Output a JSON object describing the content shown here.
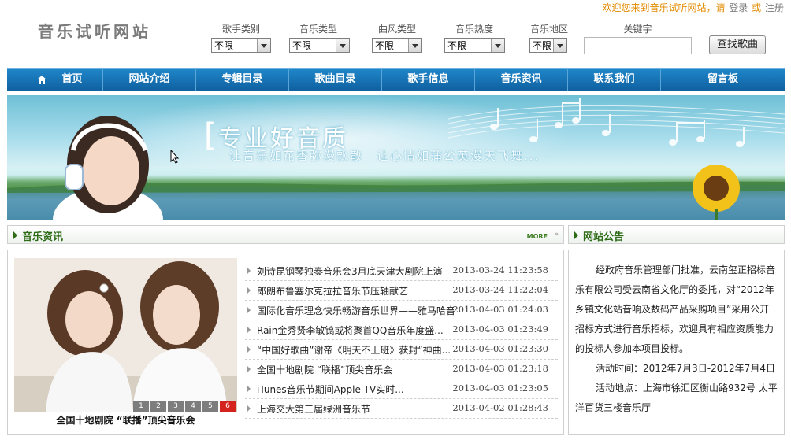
{
  "header": {
    "site_title": "音乐试听网站",
    "welcome_text": "欢迎您来到音乐试听网站，请",
    "login_label": "登录",
    "or_text": "或",
    "register_label": "注册"
  },
  "filters": [
    {
      "label": "歌手类别",
      "value": "不限"
    },
    {
      "label": "音乐类型",
      "value": "不限"
    },
    {
      "label": "曲风类型",
      "value": "不限"
    },
    {
      "label": "音乐热度",
      "value": "不限"
    },
    {
      "label": "音乐地区",
      "value": "不限"
    }
  ],
  "search": {
    "keyword_label": "关键字",
    "keyword_value": "",
    "button_label": "查找歌曲"
  },
  "nav": {
    "items": [
      "首页",
      "网站介绍",
      "专辑目录",
      "歌曲目录",
      "歌手信息",
      "音乐资讯",
      "联系我们",
      "留言板"
    ]
  },
  "banner": {
    "title": "专业好音质",
    "subtitle": "让音乐如花香弥漫飘散　让心情如蒲公英漫天飞舞..."
  },
  "news_section": {
    "title": "音乐资讯",
    "more_label": "MORE",
    "more_arrows": "»",
    "photo_caption": "全国十地剧院 “联播”顶尖音乐会",
    "pager": [
      "1",
      "2",
      "3",
      "4",
      "5",
      "6"
    ],
    "pager_active": "6",
    "items": [
      {
        "title": "刘诗昆钢琴独奏音乐会3月底天津大剧院上演",
        "date": "2013-03-24 11:23:58"
      },
      {
        "title": "郎朗布鲁塞尔克拉拉音乐节压轴献艺",
        "date": "2013-03-24 11:22:04"
      },
      {
        "title": "国际化音乐理念快乐畅游音乐世界——雅马哈音...",
        "date": "2013-04-03 01:24:03"
      },
      {
        "title": "Rain金秀贤李敏镐或将聚首QQ音乐年度盛...",
        "date": "2013-04-03 01:23:49"
      },
      {
        "title": "“中国好歌曲”谢帝《明天不上班》获封“神曲...",
        "date": "2013-04-03 01:23:30"
      },
      {
        "title": "全国十地剧院 “联播”顶尖音乐会",
        "date": "2013-04-03 01:23:18"
      },
      {
        "title": "iTunes音乐节期间Apple TV实时...",
        "date": "2013-04-03 01:23:05"
      },
      {
        "title": "上海交大第三届绿洲音乐节",
        "date": "2013-04-02 01:28:43"
      }
    ]
  },
  "notice_section": {
    "title": "网站公告",
    "paragraphs": [
      "经政府音乐管理部门批准，云南玺正招标音乐有限公司受云南省文化厅的委托，对“2012年乡镇文化站音响及数码产品采购项目”采用公开招标方式进行音乐招标，欢迎具有相应资质能力的投标人参加本项目投标。",
      "活动时间：2012年7月3日-2012年7月4日",
      "活动地点：上海市徐汇区衡山路932号 太平洋百货三楼音乐厅"
    ]
  },
  "colors": {
    "nav_bg": "#1a78bd",
    "section_green": "#2d6b17",
    "welcome_orange": "#e38b00",
    "pager_active": "#d4231c"
  }
}
